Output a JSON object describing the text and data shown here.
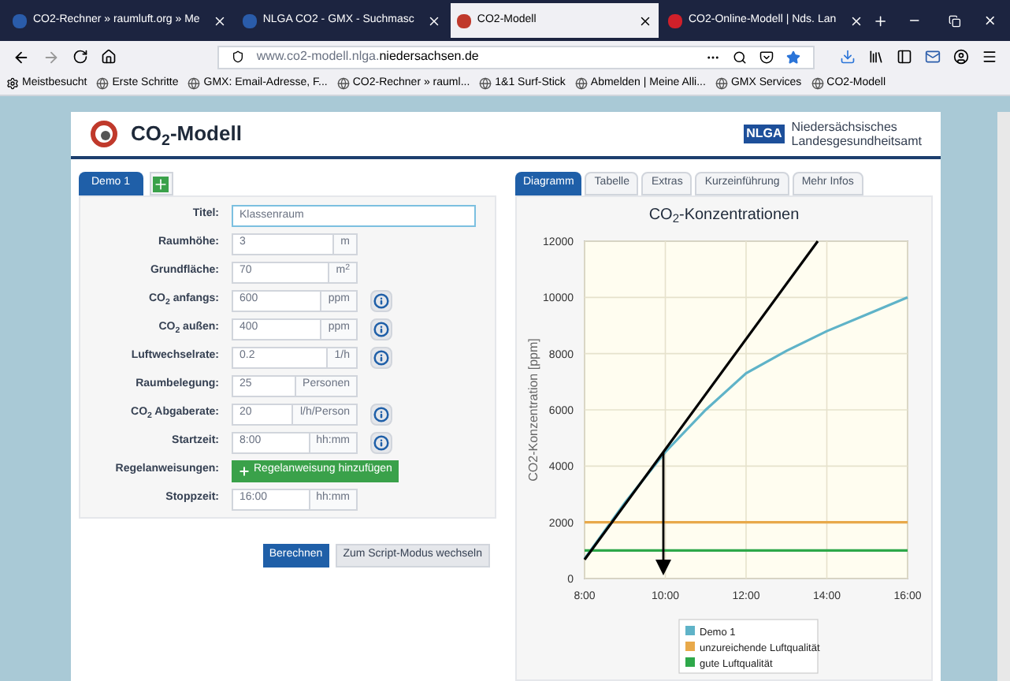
{
  "browser": {
    "tabs": [
      {
        "title": "CO2-Rechner » raumluft.org » Me",
        "selected": false,
        "color": "#2a5caa"
      },
      {
        "title": "NLGA CO2 - GMX - Suchmasc",
        "selected": false,
        "color": "#2a5caa"
      },
      {
        "title": "CO2-Modell",
        "selected": true,
        "color": "#c0392b"
      },
      {
        "title": "CO2-Online-Modell | Nds. Lan",
        "selected": false,
        "color": "#d0202a"
      }
    ],
    "url_prefix": "www.co2-modell.nlga.",
    "url_domain": "niedersachsen.de",
    "bookmarks": [
      "Meistbesucht",
      "Erste Schritte",
      "GMX: Email-Adresse, F...",
      "CO2-Rechner » rauml...",
      "1&1 Surf-Stick",
      "Abmelden | Meine Alli...",
      "GMX Services",
      "CO2-Modell"
    ]
  },
  "header": {
    "title": "CO$_{2}$-Modell",
    "agency_short": "NLGA",
    "agency_line1": "Niedersächsisches",
    "agency_line2": "Landesgesundheitsamt"
  },
  "scenario_tabs": [
    {
      "label": "Demo 1",
      "selected": true
    }
  ],
  "form": [
    {
      "kind": "text",
      "label": "Titel:",
      "value": "Klassenraum"
    },
    {
      "kind": "input",
      "label": "Raumhöhe:",
      "value": "3",
      "unit": "m",
      "info": false
    },
    {
      "kind": "input",
      "label": "Grundfläche:",
      "value": "70",
      "unit": "m$^{2}$",
      "info": false
    },
    {
      "kind": "input",
      "label": "CO$_{2}$ anfangs:",
      "value": "600",
      "unit": "ppm",
      "info": true
    },
    {
      "kind": "input",
      "label": "CO$_{2}$ außen:",
      "value": "400",
      "unit": "ppm",
      "info": true
    },
    {
      "kind": "input",
      "label": "Luftwechselrate:",
      "value": "0.2",
      "unit": "1/h",
      "info": true
    },
    {
      "kind": "input",
      "label": "Raumbelegung:",
      "value": "25",
      "unit": "Personen",
      "info": false
    },
    {
      "kind": "input",
      "label": "CO$_{2}$ Abgaberate:",
      "value": "20",
      "unit": "l/h/Person",
      "info": true
    },
    {
      "kind": "input",
      "label": "Startzeit:",
      "value": "8:00",
      "unit": "hh:mm",
      "info": true
    },
    {
      "kind": "button",
      "label": "Regelanweisungen:",
      "button": "Regelanweisung hinzufügen"
    },
    {
      "kind": "input",
      "label": "Stoppzeit:",
      "value": "16:00",
      "unit": "hh:mm",
      "info": false
    }
  ],
  "actions": [
    {
      "label": "Berechnen",
      "primary": true
    },
    {
      "label": "Zum Script-Modus wechseln",
      "primary": false
    }
  ],
  "result_tabs": [
    {
      "label": "Diagramm",
      "selected": true
    },
    {
      "label": "Tabelle",
      "selected": false
    },
    {
      "label": "Extras",
      "selected": false
    },
    {
      "label": "Kurzeinführung",
      "selected": false
    },
    {
      "label": "Mehr Infos",
      "selected": false
    }
  ],
  "chart": {
    "chart_data": {
      "type": "line",
      "title": "CO$_{2}$-Konzentrationen",
      "ylabel": "CO2-Konzentration  [ppm]",
      "x": [
        8,
        9,
        10,
        11,
        12,
        13,
        14,
        15,
        16
      ],
      "xlim": [
        8,
        16
      ],
      "ylim": [
        0,
        12000
      ],
      "xticks": [
        {
          "value": 8,
          "label": "8:00"
        },
        {
          "value": 10,
          "label": "10:00"
        },
        {
          "value": 12,
          "label": "12:00"
        },
        {
          "value": 14,
          "label": "14:00"
        },
        {
          "value": 16,
          "label": "16:00"
        }
      ],
      "yticks": [
        0,
        2000,
        4000,
        6000,
        8000,
        10000,
        12000
      ],
      "series": [
        {
          "name": "Demo 1",
          "color": "#5fb3c8",
          "values": [
            700,
            2700,
            4500,
            6000,
            7300,
            8100,
            8800,
            9400,
            10000
          ]
        },
        {
          "name": "unzureichende Luftqualität",
          "color": "#e8a94a",
          "values": [
            2000,
            2000,
            2000,
            2000,
            2000,
            2000,
            2000,
            2000,
            2000
          ]
        },
        {
          "name": "gute Luftqualität",
          "color": "#2ea84a",
          "values": [
            1000,
            1000,
            1000,
            1000,
            1000,
            1000,
            1000,
            1000,
            1000
          ]
        }
      ],
      "grid": true,
      "legend": true
    }
  }
}
